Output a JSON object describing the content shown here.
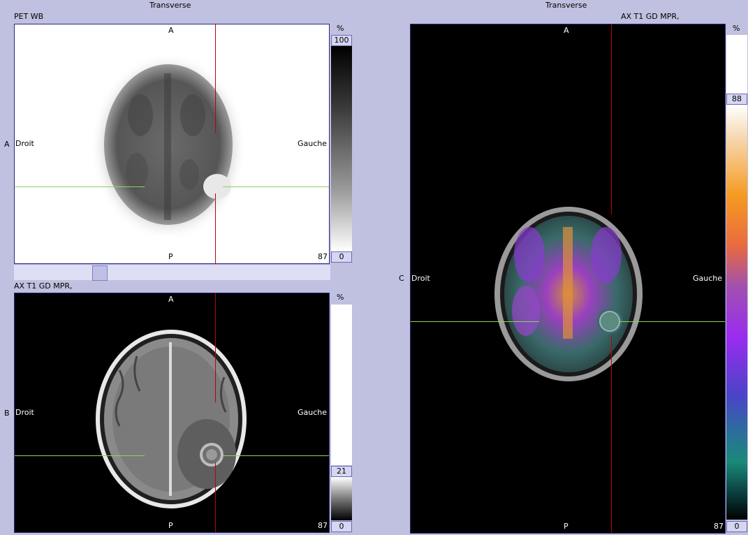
{
  "headers": {
    "left_title": "Transverse",
    "right_title": "Transverse"
  },
  "panel_a": {
    "letter": "A",
    "series": "PET WB",
    "top": "A",
    "bottom": "P",
    "left": "Droit",
    "right": "Gauche",
    "slice": "87",
    "scale_unit": "%",
    "scale_max": "100",
    "scale_min": "0",
    "slider_level": 0.26
  },
  "panel_b": {
    "letter": "B",
    "series": "AX T1 GD MPR,",
    "top": "A",
    "bottom": "P",
    "left": "Droit",
    "right": "Gauche",
    "slice": "87",
    "scale_unit": "%",
    "scale_max": "21",
    "scale_min": "0"
  },
  "panel_c": {
    "letter": "C",
    "series": "AX T1 GD MPR,",
    "top": "A",
    "bottom": "P",
    "left": "Droit",
    "right": "Gauche",
    "slice": "87",
    "scale_unit": "%",
    "scale_max": "88",
    "scale_min": "0"
  },
  "colors": {
    "crosshair_horizontal": "#8ad65a",
    "crosshair_vertical": "#c00000",
    "panel_background": "#c0c0e0"
  }
}
